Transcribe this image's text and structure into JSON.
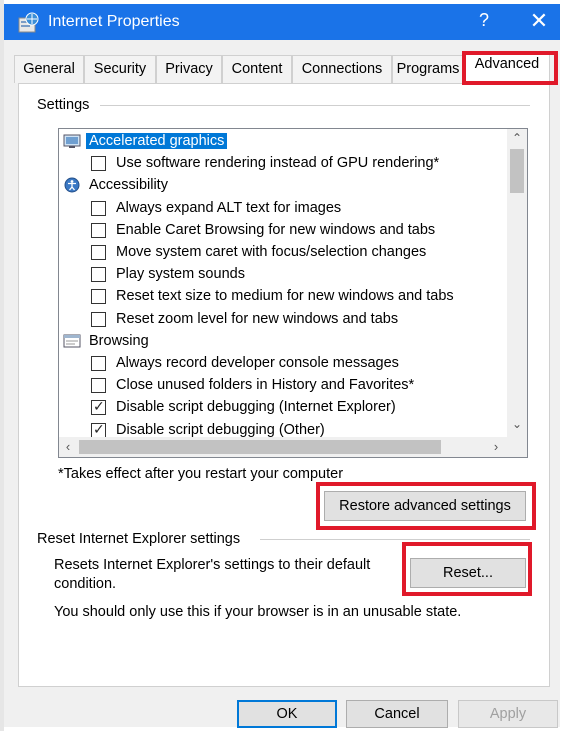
{
  "window": {
    "title": "Internet Properties",
    "help_label": "?",
    "close_label": "✕"
  },
  "tabs": [
    {
      "label": "General"
    },
    {
      "label": "Security"
    },
    {
      "label": "Privacy"
    },
    {
      "label": "Content"
    },
    {
      "label": "Connections"
    },
    {
      "label": "Programs"
    },
    {
      "label": "Advanced"
    }
  ],
  "active_tab": "Advanced",
  "settings": {
    "group_label": "Settings",
    "items": [
      {
        "kind": "category",
        "icon": "monitor-icon",
        "label": "Accelerated graphics",
        "selected": true
      },
      {
        "kind": "option",
        "checked": false,
        "label": "Use software rendering instead of GPU rendering*"
      },
      {
        "kind": "category",
        "icon": "accessibility-icon",
        "label": "Accessibility"
      },
      {
        "kind": "option",
        "checked": false,
        "label": "Always expand ALT text for images"
      },
      {
        "kind": "option",
        "checked": false,
        "label": "Enable Caret Browsing for new windows and tabs"
      },
      {
        "kind": "option",
        "checked": false,
        "label": "Move system caret with focus/selection changes"
      },
      {
        "kind": "option",
        "checked": false,
        "label": "Play system sounds"
      },
      {
        "kind": "option",
        "checked": false,
        "label": "Reset text size to medium for new windows and tabs"
      },
      {
        "kind": "option",
        "checked": false,
        "label": "Reset zoom level for new windows and tabs"
      },
      {
        "kind": "category",
        "icon": "browser-window-icon",
        "label": "Browsing"
      },
      {
        "kind": "option",
        "checked": false,
        "label": "Always record developer console messages"
      },
      {
        "kind": "option",
        "checked": false,
        "label": "Close unused folders in History and Favorites*"
      },
      {
        "kind": "option",
        "checked": true,
        "label": "Disable script debugging (Internet Explorer)"
      },
      {
        "kind": "option",
        "checked": true,
        "label": "Disable script debugging (Other)"
      }
    ],
    "restart_note": "*Takes effect after you restart your computer",
    "restore_button": "Restore advanced settings"
  },
  "reset": {
    "group_label": "Reset Internet Explorer settings",
    "description_line1": "Resets Internet Explorer's settings to their default",
    "description_line2": "condition.",
    "reset_button": "Reset...",
    "warning": "You should only use this if your browser is in an unusable state."
  },
  "footer": {
    "ok": "OK",
    "cancel": "Cancel",
    "apply": "Apply"
  },
  "colors": {
    "titlebar": "#1a73e8",
    "highlight": "#e0192a",
    "selection": "#0078d7"
  }
}
